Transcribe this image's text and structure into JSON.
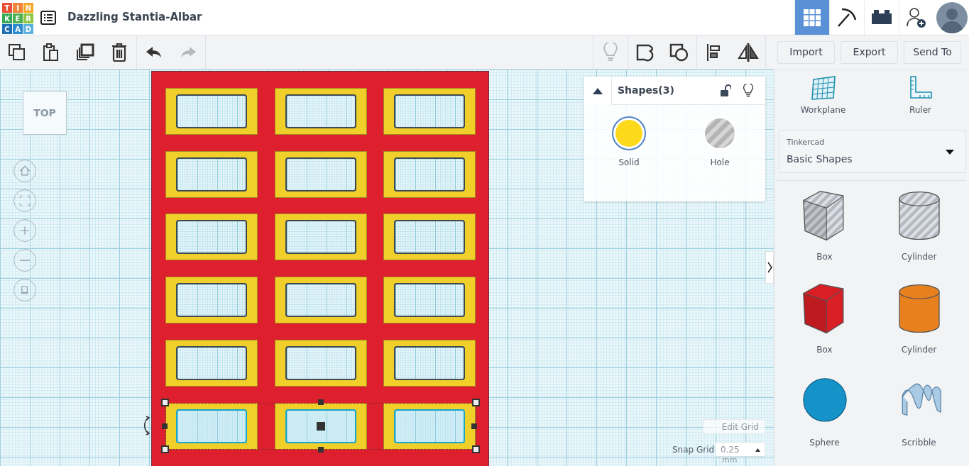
{
  "logo": [
    {
      "letter": "T",
      "color": "#e94e35"
    },
    {
      "letter": "I",
      "color": "#f0843a"
    },
    {
      "letter": "N",
      "color": "#f5a623"
    },
    {
      "letter": "K",
      "color": "#37a853"
    },
    {
      "letter": "E",
      "color": "#4cae4f"
    },
    {
      "letter": "R",
      "color": "#8dc63f"
    },
    {
      "letter": "C",
      "color": "#1f6fb5"
    },
    {
      "letter": "A",
      "color": "#2b8ad1"
    },
    {
      "letter": "D",
      "color": "#5ab0e0"
    }
  ],
  "title": "Dazzling Stantia-Albar",
  "views": [
    {
      "kind": "grid",
      "selected": true
    },
    {
      "kind": "pickaxe",
      "selected": false
    },
    {
      "kind": "bricks",
      "selected": false
    }
  ],
  "edit_tools": [
    {
      "kind": "copy",
      "disabled": false
    },
    {
      "kind": "paste",
      "disabled": false
    },
    {
      "kind": "duplicate",
      "disabled": false
    },
    {
      "kind": "delete",
      "disabled": false
    }
  ],
  "history_tools": [
    {
      "kind": "undo",
      "disabled": false
    },
    {
      "kind": "redo",
      "disabled": true
    }
  ],
  "shape_tools": [
    {
      "kind": "bulb",
      "disabled": true
    },
    {
      "kind": "group",
      "disabled": false
    },
    {
      "kind": "ungroup",
      "disabled": false
    },
    {
      "kind": "align",
      "disabled": false
    },
    {
      "kind": "mirror",
      "disabled": false
    }
  ],
  "actions": [
    "Import",
    "Export",
    "Send To"
  ],
  "view_cube": "TOP",
  "frame_rows": [
    {
      "selected": false
    },
    {
      "selected": false
    },
    {
      "selected": false
    },
    {
      "selected": false
    },
    {
      "selected": false
    },
    {
      "selected": true
    }
  ],
  "inspector": {
    "title": "Shapes(3)",
    "locked": false,
    "options": [
      {
        "label": "Solid",
        "kind": "solid",
        "selected": true
      },
      {
        "label": "Hole",
        "kind": "hole",
        "selected": false
      }
    ]
  },
  "sidebar": {
    "tools": [
      {
        "label": "Workplane",
        "kind": "workplane"
      },
      {
        "label": "Ruler",
        "kind": "ruler"
      }
    ],
    "library": {
      "label": "Tinkercad",
      "value": "Basic Shapes"
    },
    "shapes": [
      {
        "label": "Box",
        "kind": "box",
        "hole": true,
        "color": "#b4b8c0"
      },
      {
        "label": "Cylinder",
        "kind": "cylinder",
        "hole": true,
        "color": "#b4b8c0"
      },
      {
        "label": "Box",
        "kind": "box",
        "hole": false,
        "color": "#d91f26"
      },
      {
        "label": "Cylinder",
        "kind": "cylinder",
        "hole": false,
        "color": "#e8801e"
      },
      {
        "label": "Sphere",
        "kind": "sphere",
        "hole": false,
        "color": "#1592c8"
      },
      {
        "label": "Scribble",
        "kind": "scribble",
        "hole": false,
        "color": "#a9cbe6"
      }
    ]
  },
  "grid": {
    "edit": "Edit Grid",
    "snap_label": "Snap Grid",
    "snap_value": "0.25",
    "unit": "mm"
  }
}
